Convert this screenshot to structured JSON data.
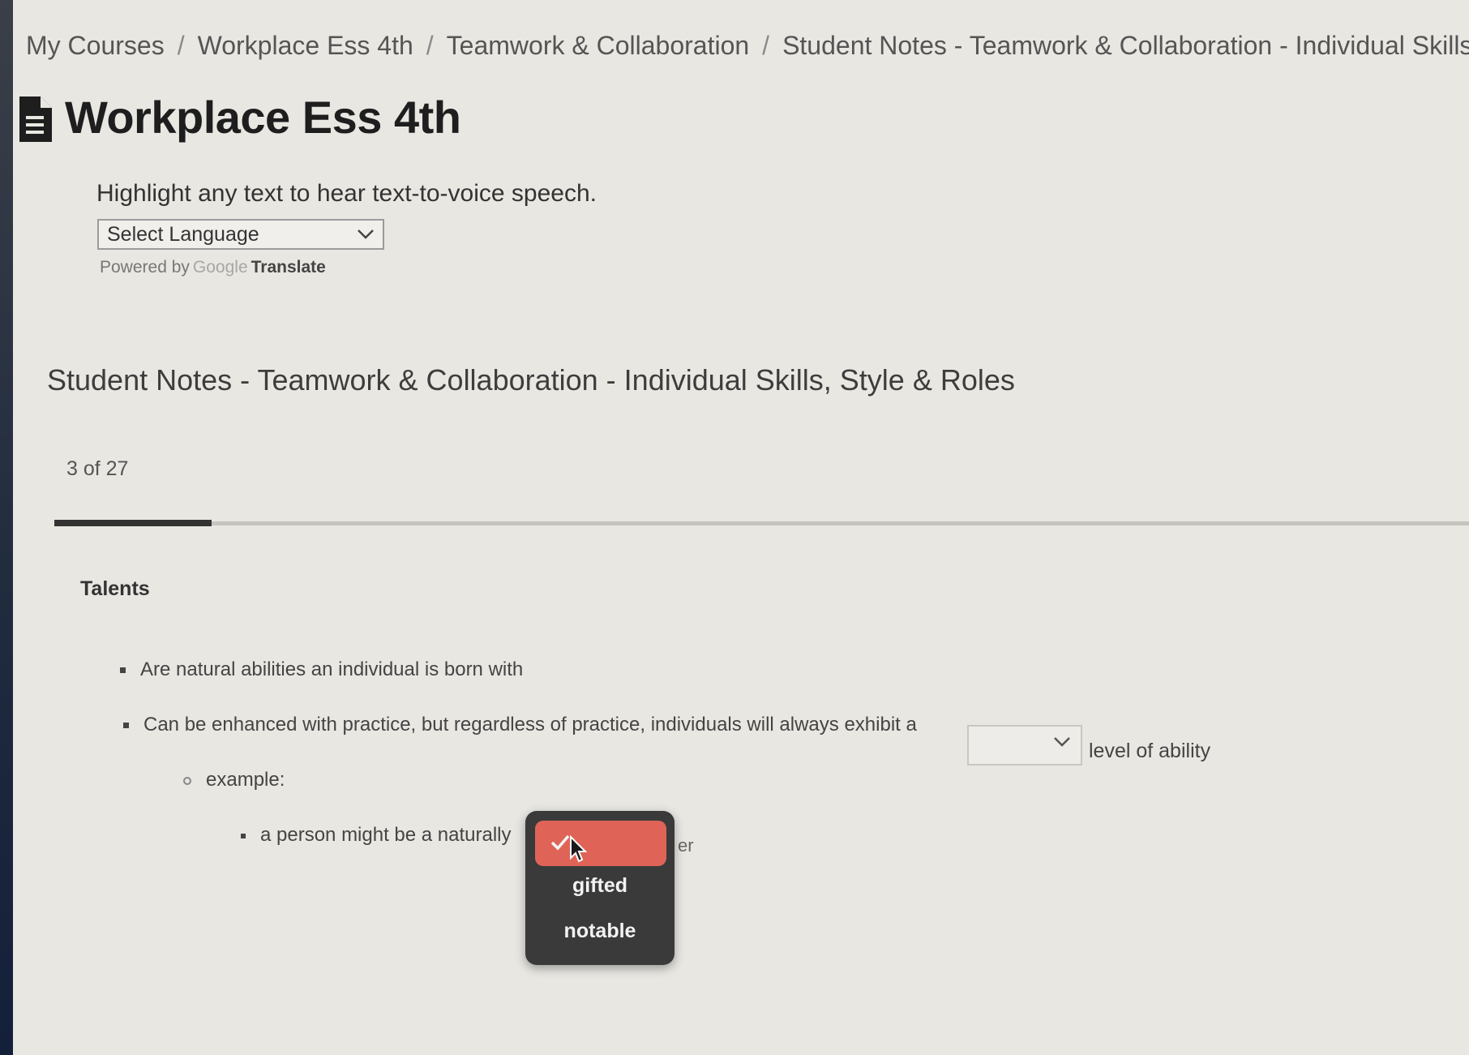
{
  "breadcrumb": {
    "items": [
      "My Courses",
      "Workplace Ess 4th",
      "Teamwork & Collaboration",
      "Student Notes - Teamwork & Collaboration - Individual Skills, S"
    ],
    "separator": "/"
  },
  "page_title": "Workplace Ess 4th",
  "tts_hint": "Highlight any text to hear text-to-voice speech.",
  "language_select": {
    "value": "Select Language"
  },
  "powered_by": {
    "prefix": "Powered by",
    "brand": "Google",
    "product": "Translate"
  },
  "notes_title": "Student Notes - Teamwork & Collaboration - Individual Skills, Style & Roles",
  "pagination": {
    "text": "3 of 27",
    "current": 3,
    "total": 27
  },
  "section": {
    "heading": "Talents",
    "bullet_1": "Are natural abilities an individual is born with",
    "bullet_2_before": "Can be enhanced with practice, but regardless of practice, individuals will always exhibit a",
    "bullet_2_after": "level of ability",
    "sub_bullet": "example:",
    "sub_sub_bullet_before": "a person might be a naturally",
    "sub_sub_bullet_after_fragment": "er"
  },
  "dropdown": {
    "options": [
      "gifted",
      "notable"
    ]
  },
  "colors": {
    "dropdown_bg": "#3a3a3a",
    "dropdown_selected": "#df6457",
    "progress_fill": "#333333"
  }
}
